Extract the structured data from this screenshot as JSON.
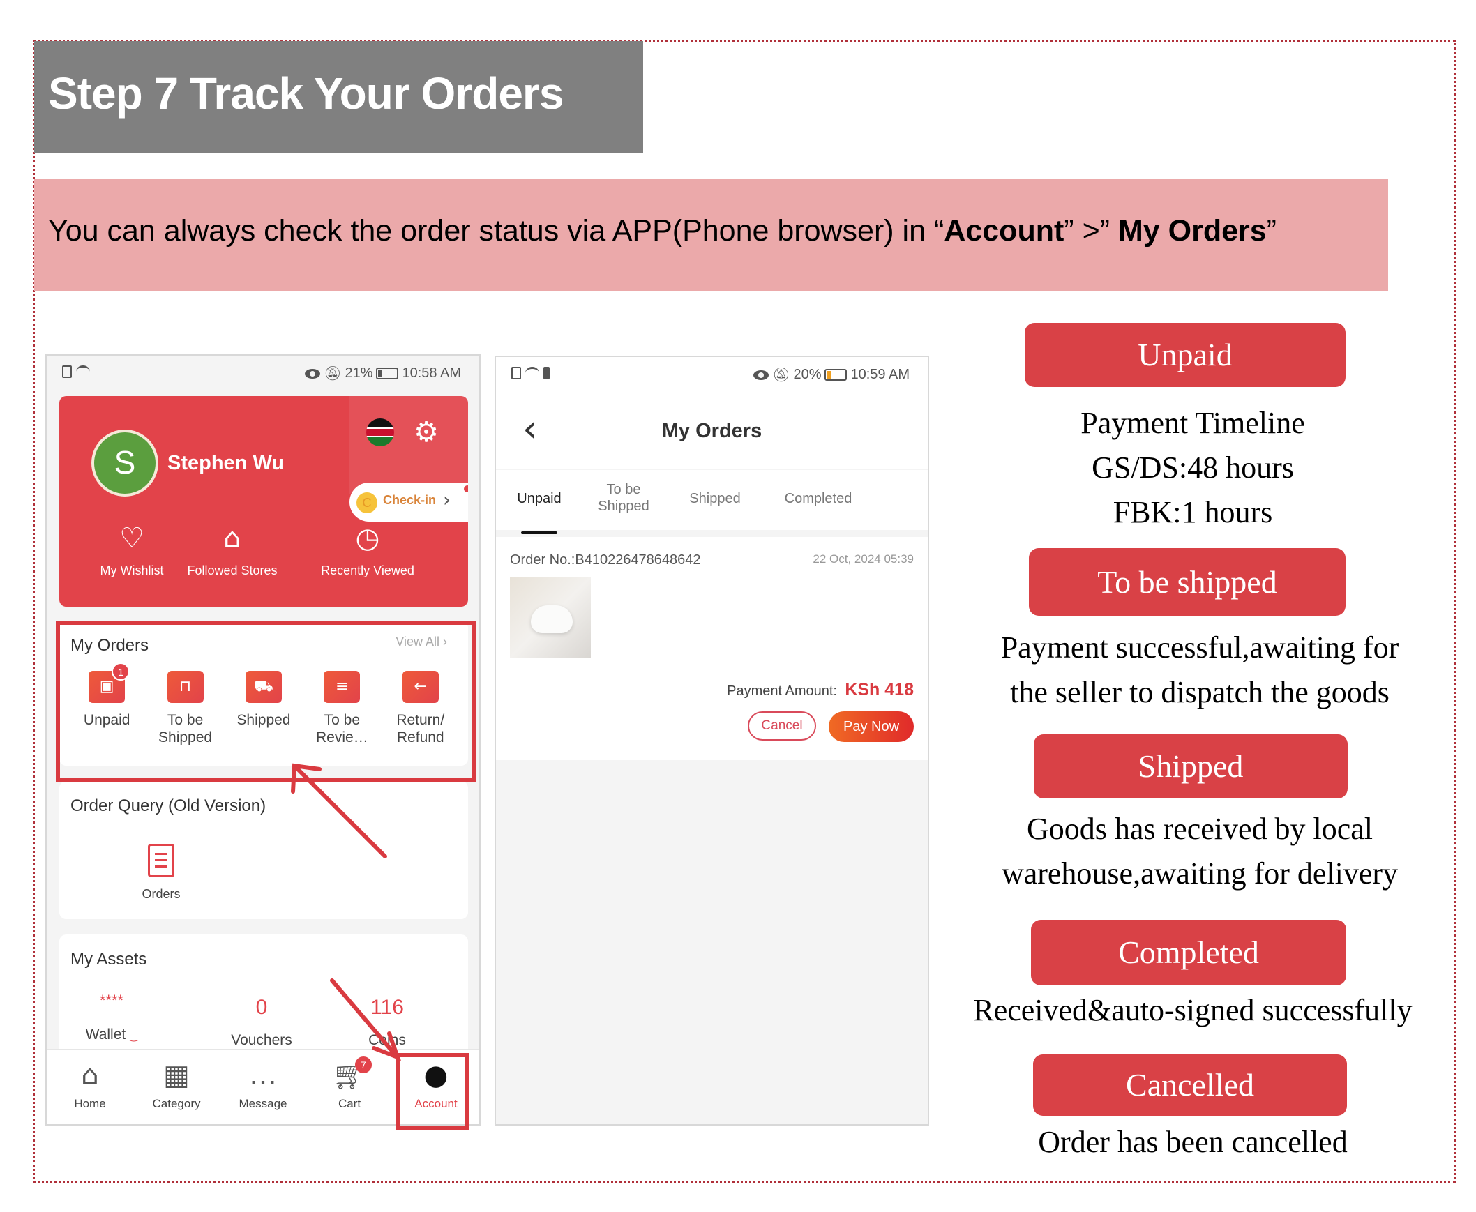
{
  "slide": {
    "title": "Step 7 Track Your Orders",
    "instruction": {
      "prefix": "You can always check the order status via APP(Phone browser) in “",
      "account": "Account",
      "middle": "”  >”  ",
      "my_orders": "My Orders",
      "suffix": "”"
    }
  },
  "phone_account": {
    "status_bar": {
      "battery": "21%",
      "time": "10:58 AM",
      "battery_level": 0.21
    },
    "profile": {
      "initial": "S",
      "name": "Stephen Wu",
      "flag": "kenya-flag-icon",
      "settings_icon": "gear-icon"
    },
    "checkin": {
      "coin": "C",
      "label": "Check-in"
    },
    "quick_links": [
      {
        "label": "My Wishlist",
        "icon": "heart-icon"
      },
      {
        "label": "Followed Stores",
        "icon": "store-icon"
      },
      {
        "label": "Recently Viewed",
        "icon": "clock-icon"
      }
    ],
    "my_orders": {
      "title": "My Orders",
      "view_all": "View All",
      "items": [
        {
          "label": "Unpaid",
          "icon": "wallet-icon",
          "badge": "1"
        },
        {
          "label": "To be Shipped",
          "icon": "package-icon"
        },
        {
          "label": "Shipped",
          "icon": "truck-icon"
        },
        {
          "label": "To be Revie…",
          "icon": "review-icon"
        },
        {
          "label": "Return/ Refund",
          "icon": "return-box-icon"
        }
      ]
    },
    "order_query": {
      "title": "Order Query (Old Version)",
      "item_label": "Orders"
    },
    "my_assets": {
      "title": "My Assets",
      "wallet": {
        "value": "****",
        "label": "Wallet"
      },
      "vouchers": {
        "value": "0",
        "label": "Vouchers"
      },
      "coins": {
        "value": "116",
        "label": "Coins"
      }
    },
    "tabbar": [
      {
        "label": "Home",
        "icon": "home-icon"
      },
      {
        "label": "Category",
        "icon": "category-icon"
      },
      {
        "label": "Message",
        "icon": "message-icon"
      },
      {
        "label": "Cart",
        "icon": "cart-icon",
        "badge": "7"
      },
      {
        "label": "Account",
        "icon": "account-icon",
        "active": true
      }
    ]
  },
  "phone_orders": {
    "status_bar": {
      "battery": "20%",
      "time": "10:59 AM",
      "battery_level": 0.2
    },
    "title": "My Orders",
    "tabs": [
      {
        "label": "Unpaid",
        "active": true
      },
      {
        "label": "To be Shipped"
      },
      {
        "label": "Shipped"
      },
      {
        "label": "Completed"
      }
    ],
    "order": {
      "number": "Order No.:B410226478648642",
      "date": "22 Oct, 2024 05:39",
      "payment_label": "Payment Amount:",
      "payment_amount": "KSh 418",
      "cancel_label": "Cancel",
      "pay_label": "Pay Now"
    }
  },
  "statuses": [
    {
      "label": "Unpaid",
      "description": [
        "Payment Timeline",
        "GS/DS:48 hours",
        "FBK:1 hours"
      ]
    },
    {
      "label": "To be shipped",
      "description": [
        "Payment successful,awaiting for",
        "the seller to dispatch the goods"
      ]
    },
    {
      "label": "Shipped",
      "description": [
        "Goods has received by local",
        "warehouse,awaiting for delivery"
      ]
    },
    {
      "label": "Completed",
      "description": [
        "Received&auto-signed successfully"
      ]
    },
    {
      "label": "Cancelled",
      "description": [
        "Order has been cancelled"
      ]
    }
  ],
  "colors": {
    "accent": "#d94146",
    "title_bg": "#808080",
    "banner_bg": "#eba9aa",
    "app_red": "#e2434a"
  }
}
